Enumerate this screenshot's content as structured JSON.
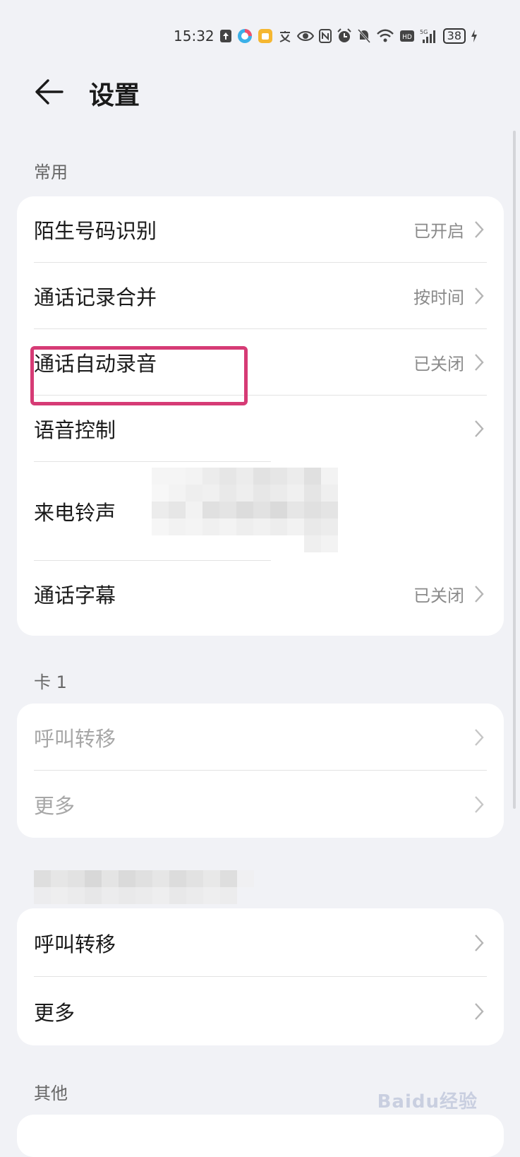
{
  "status_bar": {
    "time": "15:32",
    "network": "5G",
    "battery": "38"
  },
  "header": {
    "title": "设置"
  },
  "sections": {
    "common": {
      "label": "常用",
      "items": [
        {
          "label": "陌生号码识别",
          "value": "已开启"
        },
        {
          "label": "通话记录合并",
          "value": "按时间"
        },
        {
          "label": "通话自动录音",
          "value": "已关闭"
        },
        {
          "label": "语音控制",
          "value": ""
        },
        {
          "label": "来电铃声",
          "value": ""
        },
        {
          "label": "通话字幕",
          "value": "已关闭"
        }
      ]
    },
    "sim1": {
      "label": "卡 1",
      "items": [
        {
          "label": "呼叫转移"
        },
        {
          "label": "更多"
        }
      ]
    },
    "sim2": {
      "items": [
        {
          "label": "呼叫转移"
        },
        {
          "label": "更多"
        }
      ]
    },
    "other": {
      "label": "其他"
    }
  },
  "watermark": "Baidu经验",
  "colors": {
    "highlight": "#d63b75",
    "background": "#f1f2f6"
  }
}
